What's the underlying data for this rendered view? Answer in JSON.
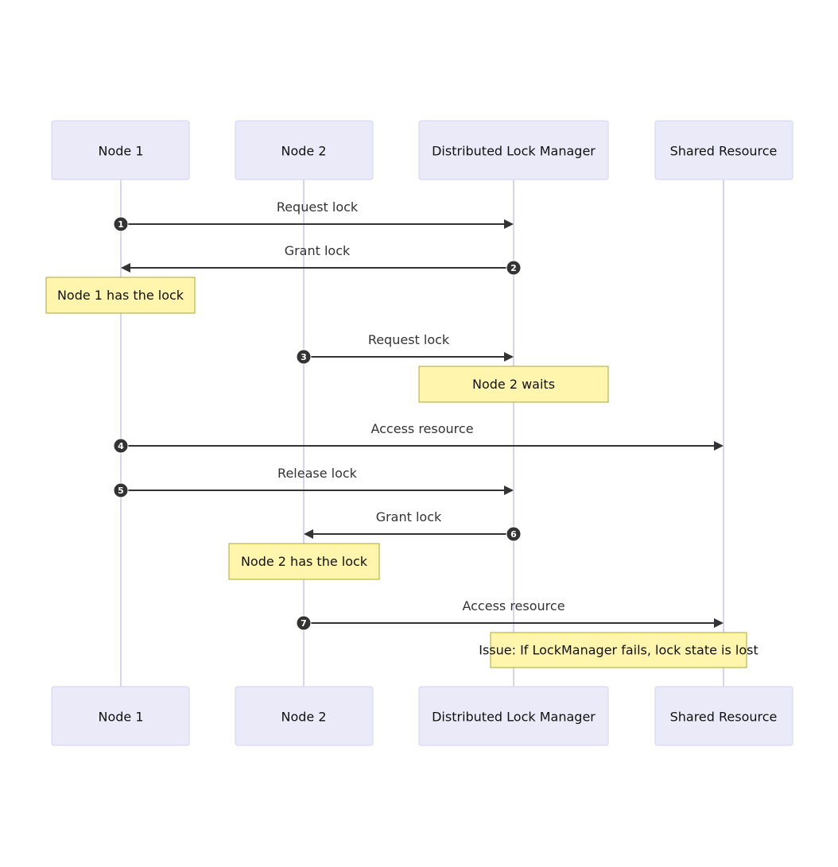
{
  "diagram": {
    "type": "sequence",
    "colors": {
      "actor_fill": "#eaeaf9",
      "actor_border": "#d6d0f3",
      "lifeline": "#d9d2f2",
      "message": "#333333",
      "note_fill": "#fff5ad",
      "note_border": "#aaaa33"
    },
    "participants": [
      {
        "id": "n1",
        "label": "Node 1"
      },
      {
        "id": "n2",
        "label": "Node 2"
      },
      {
        "id": "dlm",
        "label": "Distributed Lock Manager"
      },
      {
        "id": "sr",
        "label": "Shared Resource"
      }
    ],
    "events": [
      {
        "kind": "message",
        "seq": "1",
        "from": "n1",
        "to": "dlm",
        "label": "Request lock"
      },
      {
        "kind": "message",
        "seq": "2",
        "from": "dlm",
        "to": "n1",
        "label": "Grant lock"
      },
      {
        "kind": "note",
        "over": [
          "n1"
        ],
        "label": "Node 1 has the lock"
      },
      {
        "kind": "message",
        "seq": "3",
        "from": "n2",
        "to": "dlm",
        "label": "Request lock"
      },
      {
        "kind": "note",
        "over": [
          "dlm"
        ],
        "label": "Node 2 waits"
      },
      {
        "kind": "message",
        "seq": "4",
        "from": "n1",
        "to": "sr",
        "label": "Access resource"
      },
      {
        "kind": "message",
        "seq": "5",
        "from": "n1",
        "to": "dlm",
        "label": "Release lock"
      },
      {
        "kind": "message",
        "seq": "6",
        "from": "dlm",
        "to": "n2",
        "label": "Grant lock"
      },
      {
        "kind": "note",
        "over": [
          "n2"
        ],
        "label": "Node 2 has the lock"
      },
      {
        "kind": "message",
        "seq": "7",
        "from": "n2",
        "to": "sr",
        "label": "Access resource"
      },
      {
        "kind": "note",
        "over": [
          "dlm",
          "sr"
        ],
        "label": "Issue: If LockManager fails, lock state is lost"
      }
    ]
  }
}
